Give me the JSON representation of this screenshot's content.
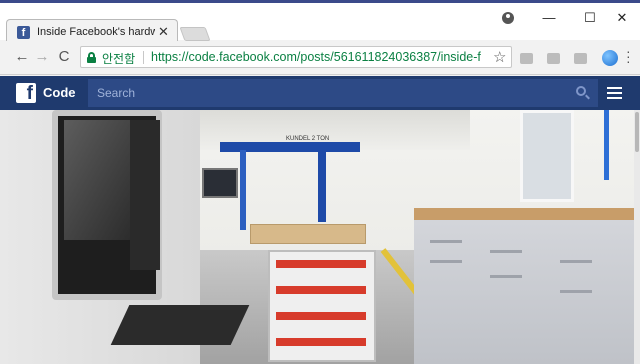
{
  "browser": {
    "tab": {
      "title": "Inside Facebook's hardw",
      "favicon": "facebook-icon",
      "close_glyph": "✕"
    },
    "window_controls": {
      "minimize": "—",
      "maximize": "☐",
      "close": "✕"
    },
    "toolbar": {
      "back_glyph": "←",
      "forward_glyph": "→",
      "reload_glyph": "C",
      "secure_label": "안전함",
      "url_host": "https://code.facebook.com",
      "url_path": "/posts/561611824036387/inside-f...",
      "star_glyph": "☆"
    }
  },
  "site": {
    "brand": "Code",
    "logo_letter": "f",
    "search_placeholder": "Search",
    "colors": {
      "nav_bg": "#1f3a6e",
      "search_bg": "#2d4a86",
      "secure_green": "#0b8043"
    }
  },
  "hero": {
    "image": "factory-floor-photo",
    "crane_label": "KUNDEL 2 TON"
  }
}
